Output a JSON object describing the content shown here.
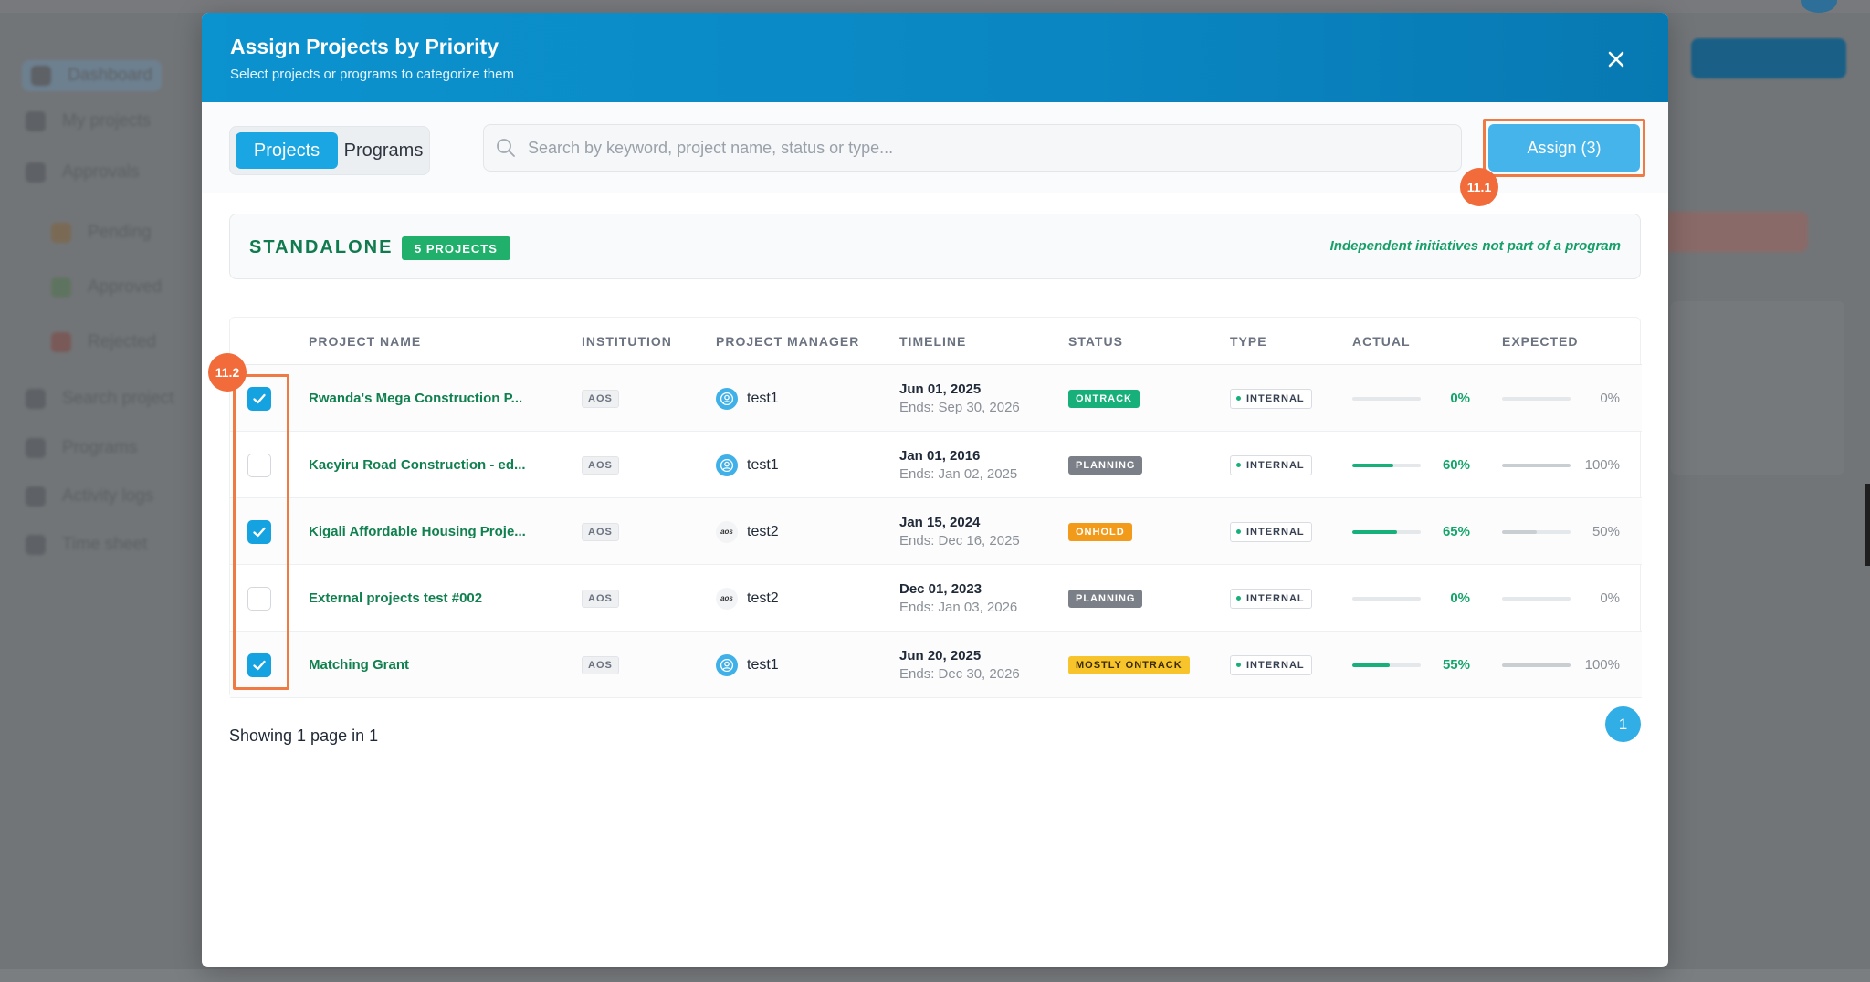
{
  "background": {
    "nav_items": [
      "Dashboard",
      "My projects",
      "Approvals",
      "Pending",
      "Approved",
      "Rejected",
      "Search project",
      "Programs",
      "Activity logs",
      "Time sheet"
    ]
  },
  "modal": {
    "title": "Assign Projects by Priority",
    "subtitle": "Select projects or programs to categorize them",
    "tabs": [
      {
        "label": "Projects",
        "active": true
      },
      {
        "label": "Programs",
        "active": false
      }
    ],
    "search_placeholder": "Search by keyword, project name, status or type...",
    "assign_label": "Assign (3)",
    "callouts": {
      "assign": "11.1",
      "checkboxes": "11.2"
    },
    "group": {
      "title": "STANDALONE",
      "count": "5 PROJECTS",
      "description": "Independent initiatives not part of a program"
    },
    "table": {
      "headers": [
        "PROJECT NAME",
        "INSTITUTION",
        "PROJECT MANAGER",
        "TIMELINE",
        "STATUS",
        "TYPE",
        "ACTUAL",
        "EXPECTED"
      ],
      "rows": [
        {
          "checked": true,
          "name": "Rwanda's Mega Construction P...",
          "institution": "AOS",
          "manager": "test1",
          "manager_avatar": "user-avatar",
          "start": "Jun 01, 2025",
          "end": "Ends: Sep 30, 2026",
          "status": "ONTRACK",
          "status_kind": "ontrack",
          "type": "INTERNAL",
          "actual": "0%",
          "actual_value": 0,
          "expected": "0%",
          "expected_value": 0
        },
        {
          "checked": false,
          "name": "Kacyiru Road Construction - ed...",
          "institution": "AOS",
          "manager": "test1",
          "manager_avatar": "user-avatar",
          "start": "Jan 01, 2016",
          "end": "Ends: Jan 02, 2025",
          "status": "PLANNING",
          "status_kind": "planning",
          "type": "INTERNAL",
          "actual": "60%",
          "actual_value": 60,
          "expected": "100%",
          "expected_value": 100
        },
        {
          "checked": true,
          "name": "Kigali Affordable Housing Proje...",
          "institution": "AOS",
          "manager": "test2",
          "manager_avatar": "logo-avatar",
          "start": "Jan 15, 2024",
          "end": "Ends: Dec 16, 2025",
          "status": "ONHOLD",
          "status_kind": "onhold",
          "type": "INTERNAL",
          "actual": "65%",
          "actual_value": 65,
          "expected": "50%",
          "expected_value": 50
        },
        {
          "checked": false,
          "name": "External projects test #002",
          "institution": "AOS",
          "manager": "test2",
          "manager_avatar": "logo-avatar",
          "start": "Dec 01, 2023",
          "end": "Ends: Jan 03, 2026",
          "status": "PLANNING",
          "status_kind": "planning",
          "type": "INTERNAL",
          "actual": "0%",
          "actual_value": 0,
          "expected": "0%",
          "expected_value": 0
        },
        {
          "checked": true,
          "name": "Matching Grant",
          "institution": "AOS",
          "manager": "test1",
          "manager_avatar": "user-avatar",
          "start": "Jun 20, 2025",
          "end": "Ends: Dec 30, 2026",
          "status": "MOSTLY ONTRACK",
          "status_kind": "mostly",
          "type": "INTERNAL",
          "actual": "55%",
          "actual_value": 55,
          "expected": "100%",
          "expected_value": 100
        }
      ]
    },
    "pagination": {
      "text": "Showing 1 page in  1",
      "current": "1"
    }
  },
  "colors": {
    "header": "#0b93cf",
    "accent": "#1aa6e2",
    "green": "#11804f",
    "callout": "#f26b3a"
  }
}
